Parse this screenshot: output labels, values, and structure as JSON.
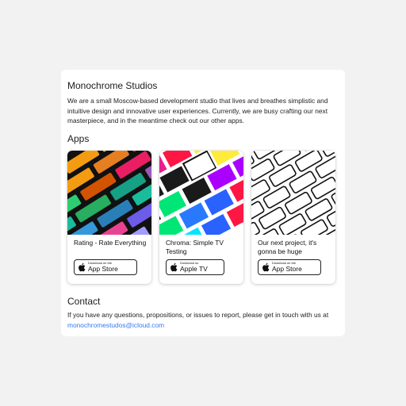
{
  "header": {
    "title": "Monochrome Studios"
  },
  "intro": "We are a small Moscow-based development studio that lives and breathes simplistic and intuitive design and innovative user experiences. Currently, we are busy crafting our next masterpiece, and in the meantime check out our other apps.",
  "apps_section": {
    "title": "Apps"
  },
  "apps": [
    {
      "name": "Rating - Rate Everything",
      "badge_small": "Download on the",
      "badge_big": "App Store"
    },
    {
      "name": "Chroma: Simple TV Testing",
      "badge_small": "Download on",
      "badge_big": "Apple TV"
    },
    {
      "name": "Our next project, it's gonna be huge",
      "badge_small": "Download on the",
      "badge_big": "App Store"
    }
  ],
  "contact": {
    "title": "Contact",
    "text": "If you have any questions, propositions, or issues to report, please get in touch with us at",
    "email": "monochromestudos@icloud.com"
  },
  "colors": {
    "link": "#2f7cf6",
    "text": "#1d1d1f",
    "background": "#f2f2f2"
  }
}
